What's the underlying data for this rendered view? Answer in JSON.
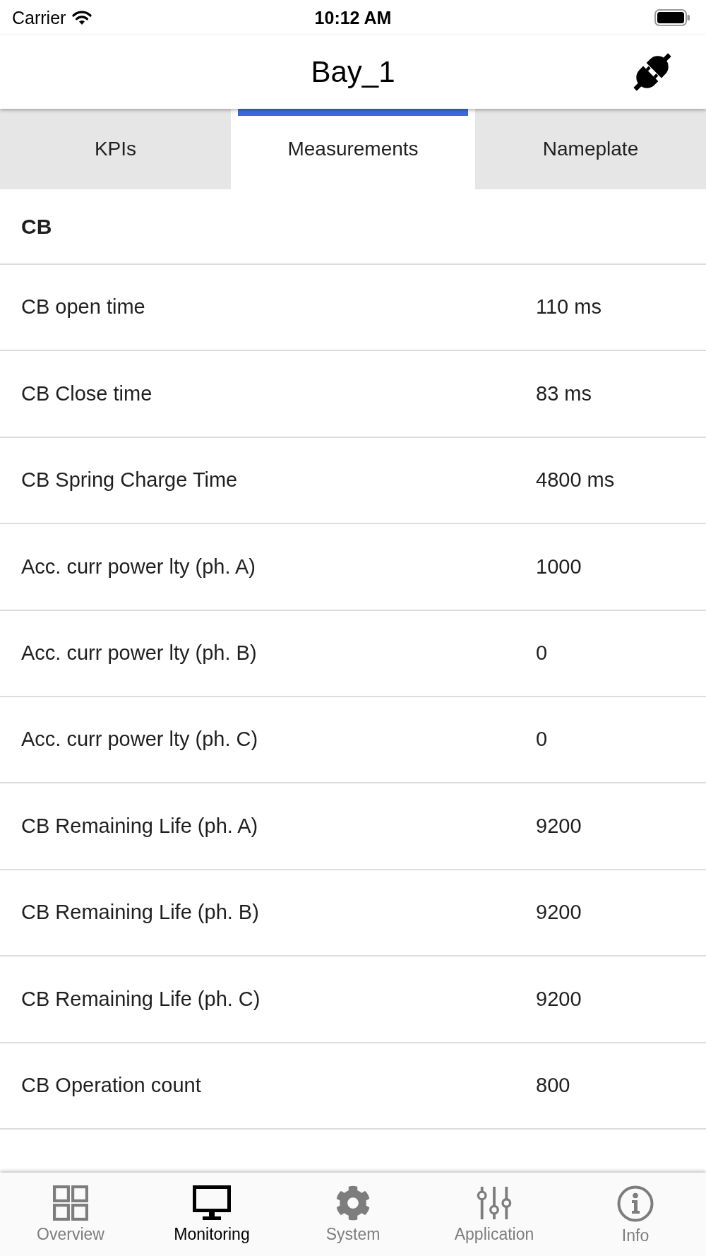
{
  "status_bar": {
    "carrier": "Carrier",
    "time": "10:12 AM"
  },
  "nav_bar": {
    "title": "Bay_1"
  },
  "tabs": [
    {
      "label": "KPIs",
      "selected": false
    },
    {
      "label": "Measurements",
      "selected": true
    },
    {
      "label": "Nameplate",
      "selected": false
    }
  ],
  "section": {
    "title": "CB",
    "rows": [
      {
        "label": "CB open time",
        "value": "110 ms"
      },
      {
        "label": "CB Close time",
        "value": "83 ms"
      },
      {
        "label": "CB Spring Charge Time",
        "value": "4800 ms"
      },
      {
        "label": "Acc. curr power lty (ph. A)",
        "value": "1000"
      },
      {
        "label": "Acc. curr power lty (ph. B)",
        "value": "0"
      },
      {
        "label": "Acc. curr power lty (ph. C)",
        "value": "0"
      },
      {
        "label": "CB Remaining Life (ph. A)",
        "value": "9200"
      },
      {
        "label": "CB Remaining Life (ph. B)",
        "value": "9200"
      },
      {
        "label": "CB Remaining Life (ph. C)",
        "value": "9200"
      },
      {
        "label": "CB Operation count",
        "value": "800"
      }
    ]
  },
  "tab_bar": [
    {
      "label": "Overview",
      "selected": false
    },
    {
      "label": "Monitoring",
      "selected": true
    },
    {
      "label": "System",
      "selected": false
    },
    {
      "label": "Application",
      "selected": false
    },
    {
      "label": "Info",
      "selected": false
    }
  ]
}
